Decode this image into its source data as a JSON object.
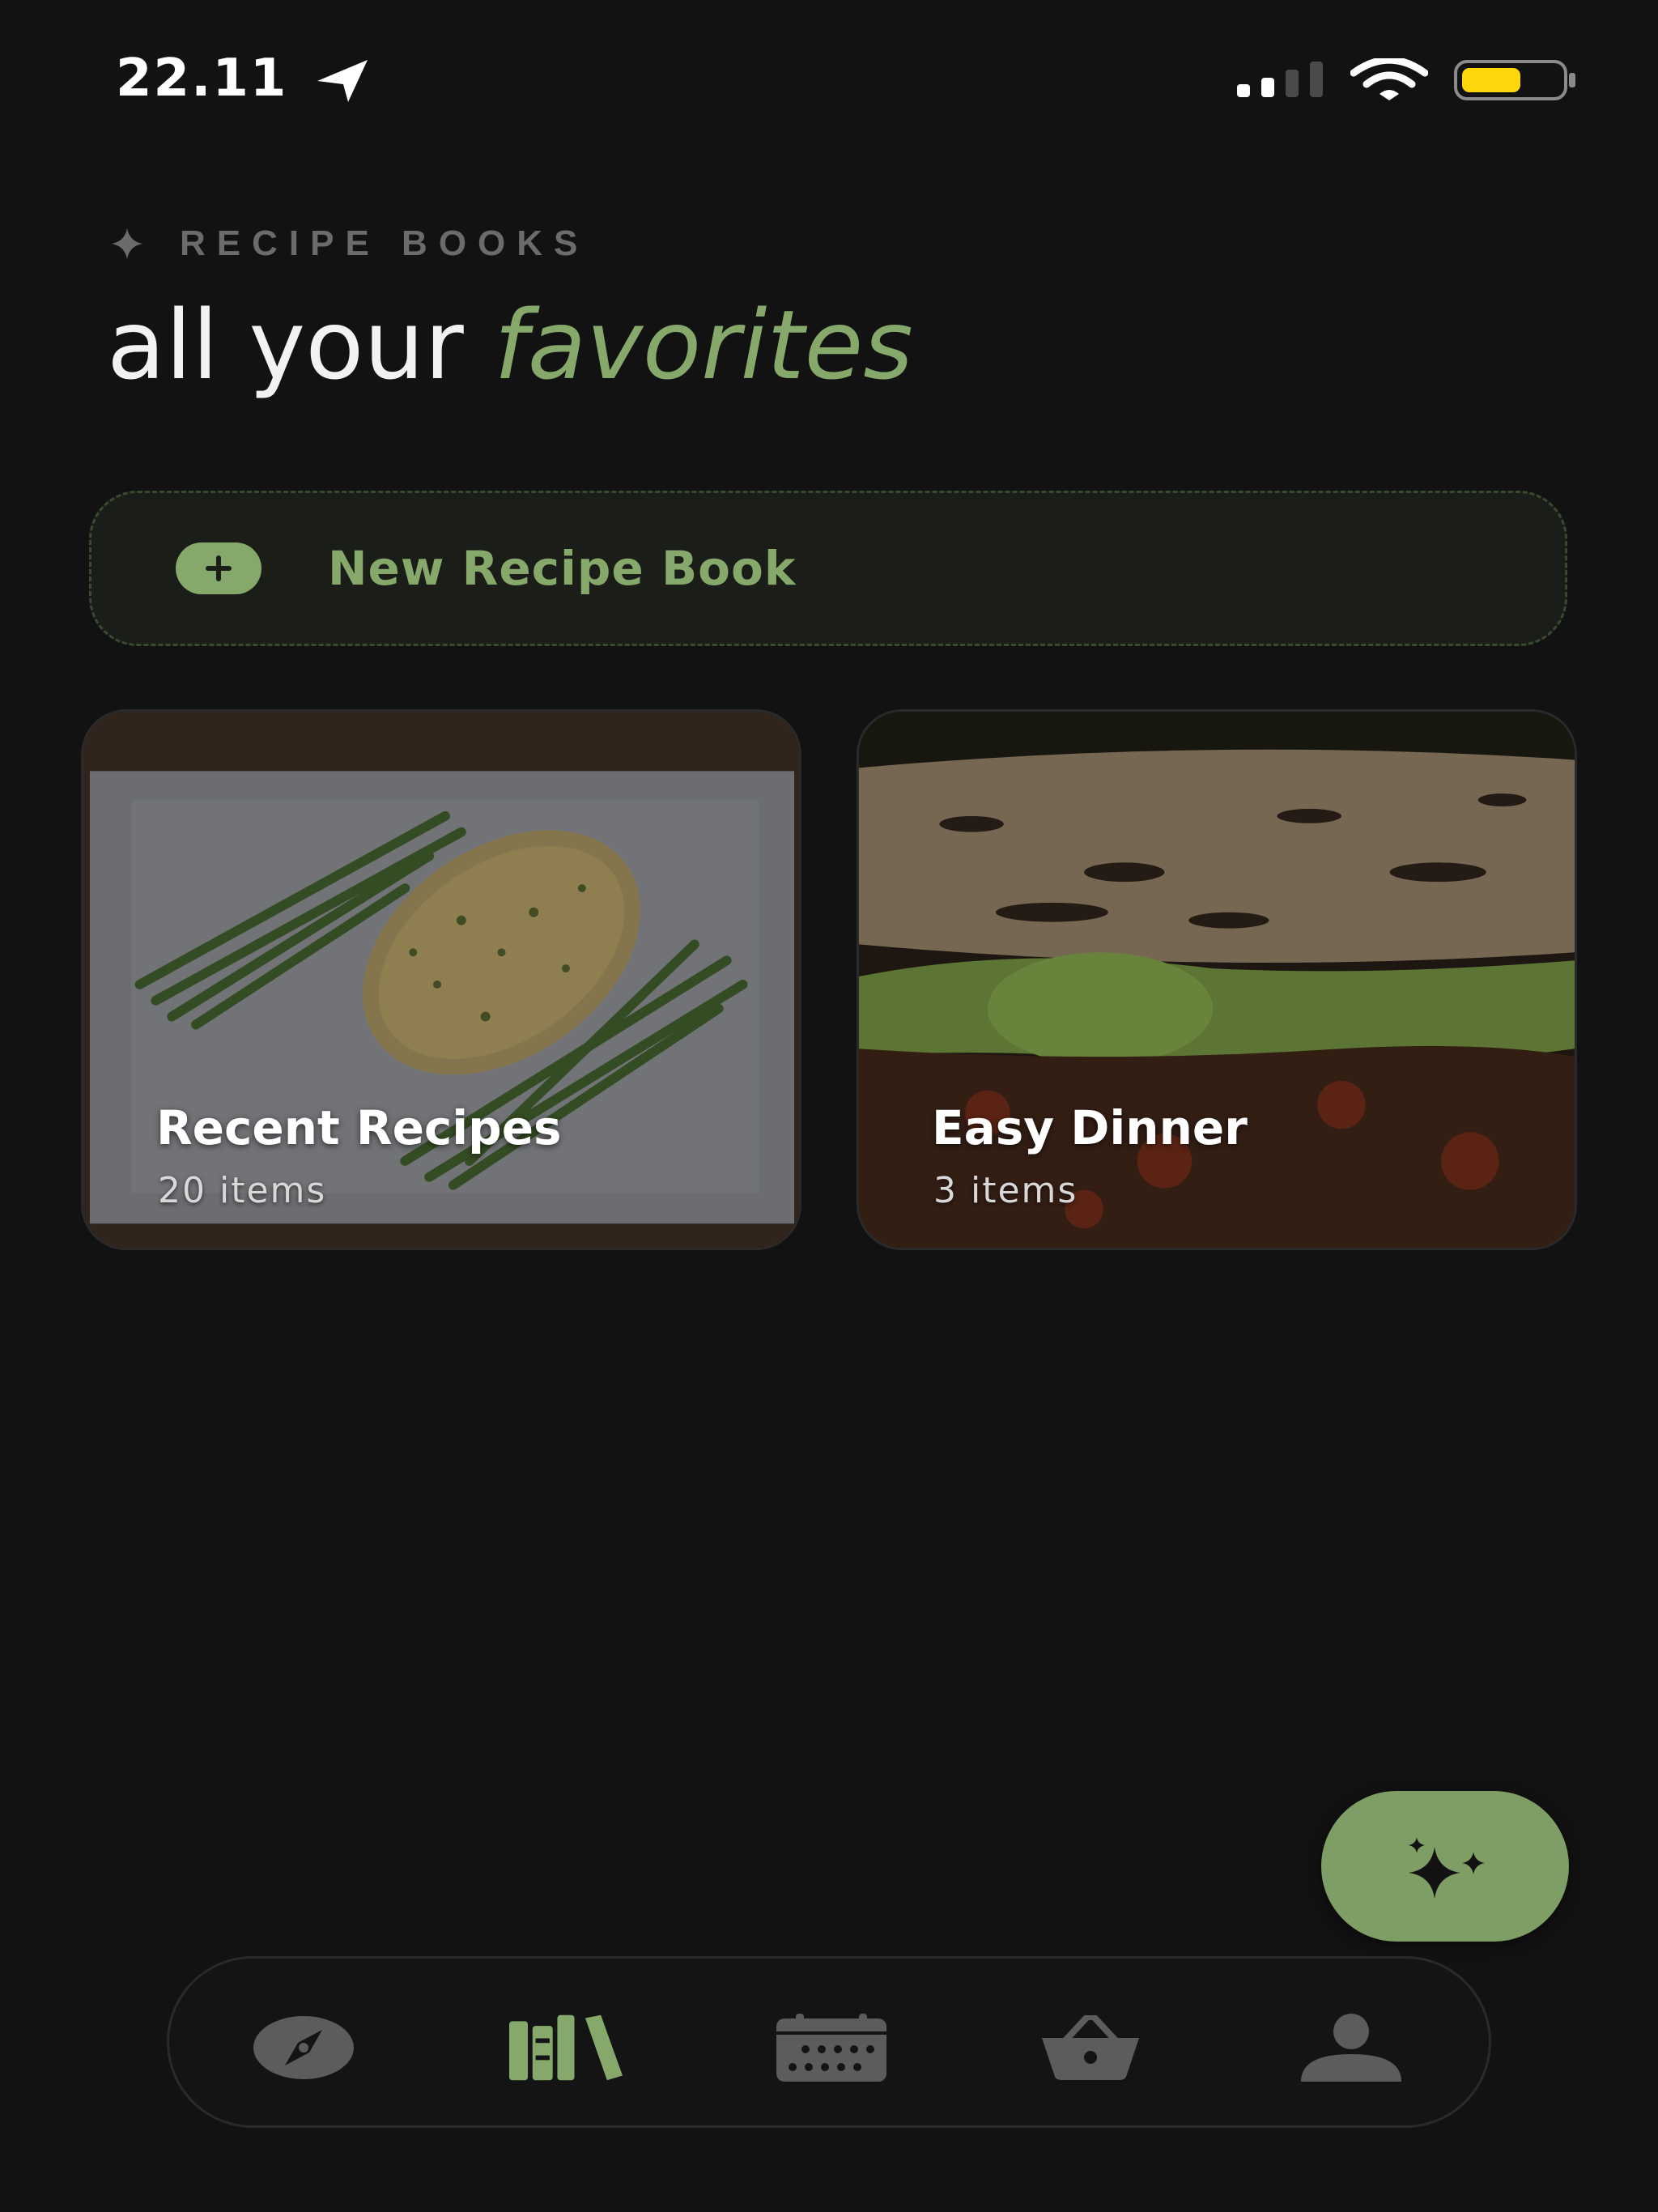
{
  "status_bar": {
    "time": "22.11",
    "battery_color": "#FFD60A"
  },
  "header": {
    "eyebrow": "RECIPE BOOKS",
    "title_plain": "all your",
    "title_accent": "favorites"
  },
  "new_book": {
    "label": "New Recipe Book"
  },
  "books": [
    {
      "title": "Recent Recipes",
      "count": "20 items"
    },
    {
      "title": "Easy Dinner",
      "count": "3 items"
    }
  ],
  "nav": {
    "items": [
      "compass-icon",
      "books-icon",
      "calendar-icon",
      "basket-icon",
      "person-icon"
    ],
    "active": "books-icon"
  },
  "colors": {
    "accent": "#86A86A",
    "background": "#121212"
  }
}
